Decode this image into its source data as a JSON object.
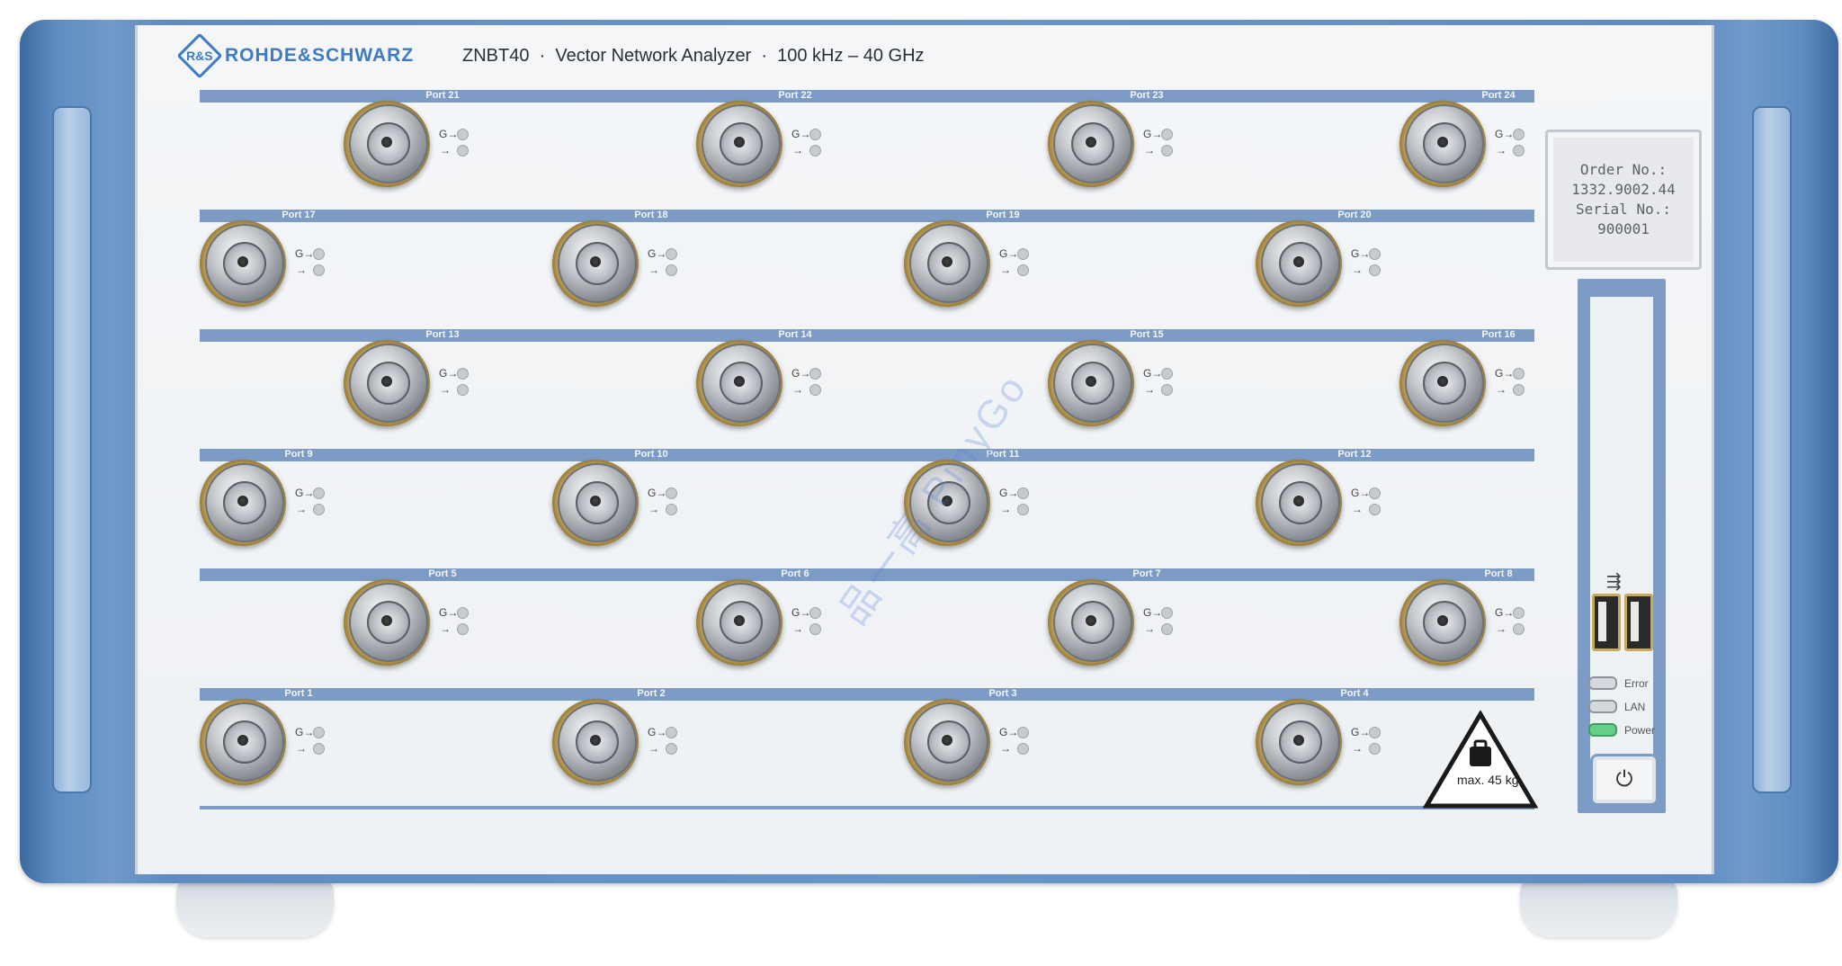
{
  "brand": {
    "logo_letter": "R&S",
    "name": "ROHDE&SCHWARZ"
  },
  "model_line": "ZNBT40  ·  Vector Network Analyzer  ·  100 kHz – 40 GHz",
  "port_rows": [
    {
      "row": 1,
      "ports": [
        "Port 21",
        "Port 22",
        "Port 23",
        "Port 24"
      ]
    },
    {
      "row": 2,
      "ports": [
        "Port 17",
        "Port 18",
        "Port 19",
        "Port 20"
      ]
    },
    {
      "row": 3,
      "ports": [
        "Port 13",
        "Port 14",
        "Port 15",
        "Port 16"
      ]
    },
    {
      "row": 4,
      "ports": [
        "Port 9",
        "Port 10",
        "Port 11",
        "Port 12"
      ]
    },
    {
      "row": 5,
      "ports": [
        "Port 5",
        "Port 6",
        "Port 7",
        "Port 8"
      ]
    },
    {
      "row": 6,
      "ports": [
        "Port 1",
        "Port 2",
        "Port 3",
        "Port 4"
      ]
    }
  ],
  "led_symbols": {
    "out": "G→",
    "in": "→"
  },
  "label_display": {
    "order_label": "Order No.:",
    "order_value": "1332.9002.44",
    "serial_label": "Serial No.:",
    "serial_value": "900001"
  },
  "usb_symbol": "⭘⊶",
  "status": [
    {
      "label": "Error",
      "on": false
    },
    {
      "label": "LAN",
      "on": false
    },
    {
      "label": "Power",
      "on": true
    }
  ],
  "power_button_symbol": "⏻",
  "weight_warning": "max. 45 kg",
  "watermark": "品一高 PinyGo",
  "colors": {
    "brand_blue": "#3d7bc4",
    "frame_blue": "#5f8cc0",
    "strip_blue": "#7d9cc5",
    "panel": "#f0f3f6",
    "power_led": "#66d08a"
  }
}
